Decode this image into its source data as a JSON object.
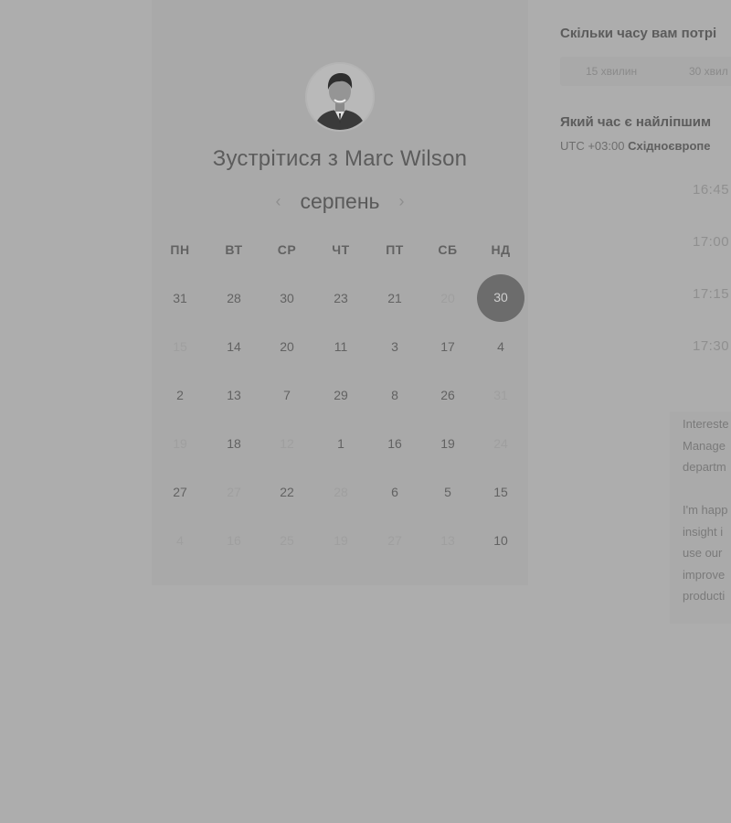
{
  "title": "Зустрітися з Marc Wilson",
  "calendar": {
    "month": "серпень",
    "prev_icon": "chevron-left-icon",
    "next_icon": "chevron-right-icon",
    "weekdays": [
      "ПН",
      "ВТ",
      "СР",
      "ЧТ",
      "ПТ",
      "СБ",
      "НД"
    ],
    "weeks": [
      [
        {
          "d": "31",
          "m": false
        },
        {
          "d": "28",
          "m": false
        },
        {
          "d": "30",
          "m": false
        },
        {
          "d": "23",
          "m": false
        },
        {
          "d": "21",
          "m": false
        },
        {
          "d": "20",
          "m": true
        },
        {
          "d": "30",
          "m": false,
          "sel": true
        }
      ],
      [
        {
          "d": "15",
          "m": true
        },
        {
          "d": "14",
          "m": false
        },
        {
          "d": "20",
          "m": false
        },
        {
          "d": "11",
          "m": false
        },
        {
          "d": "3",
          "m": false
        },
        {
          "d": "17",
          "m": false
        },
        {
          "d": "4",
          "m": false
        }
      ],
      [
        {
          "d": "2",
          "m": false
        },
        {
          "d": "13",
          "m": false
        },
        {
          "d": "7",
          "m": false
        },
        {
          "d": "29",
          "m": false
        },
        {
          "d": "8",
          "m": false
        },
        {
          "d": "26",
          "m": false
        },
        {
          "d": "31",
          "m": true
        }
      ],
      [
        {
          "d": "19",
          "m": true
        },
        {
          "d": "18",
          "m": false
        },
        {
          "d": "12",
          "m": true
        },
        {
          "d": "1",
          "m": false
        },
        {
          "d": "16",
          "m": false
        },
        {
          "d": "19",
          "m": false
        },
        {
          "d": "24",
          "m": true
        }
      ],
      [
        {
          "d": "27",
          "m": false
        },
        {
          "d": "27",
          "m": true
        },
        {
          "d": "22",
          "m": false
        },
        {
          "d": "28",
          "m": true
        },
        {
          "d": "6",
          "m": false
        },
        {
          "d": "5",
          "m": false
        },
        {
          "d": "15",
          "m": false
        }
      ],
      [
        {
          "d": "4",
          "m": true
        },
        {
          "d": "16",
          "m": true
        },
        {
          "d": "25",
          "m": true
        },
        {
          "d": "19",
          "m": true
        },
        {
          "d": "27",
          "m": true
        },
        {
          "d": "13",
          "m": true
        },
        {
          "d": "10",
          "m": false
        }
      ]
    ]
  },
  "booking": {
    "duration_question": "Скільки часу вам потрі",
    "durations": [
      "15 хвилин",
      "30 хвил"
    ],
    "time_question": "Який час є найліпшим",
    "timezone_offset": "UTC +03:00",
    "timezone_name": "Східноєвропе",
    "slots": [
      "16:45",
      "17:00",
      "17:15",
      "17:30"
    ]
  },
  "description": {
    "lines": [
      "Intereste",
      "Manage",
      "departm",
      "",
      "I'm happ",
      "insight i",
      "use our",
      "improve",
      "producti"
    ]
  }
}
